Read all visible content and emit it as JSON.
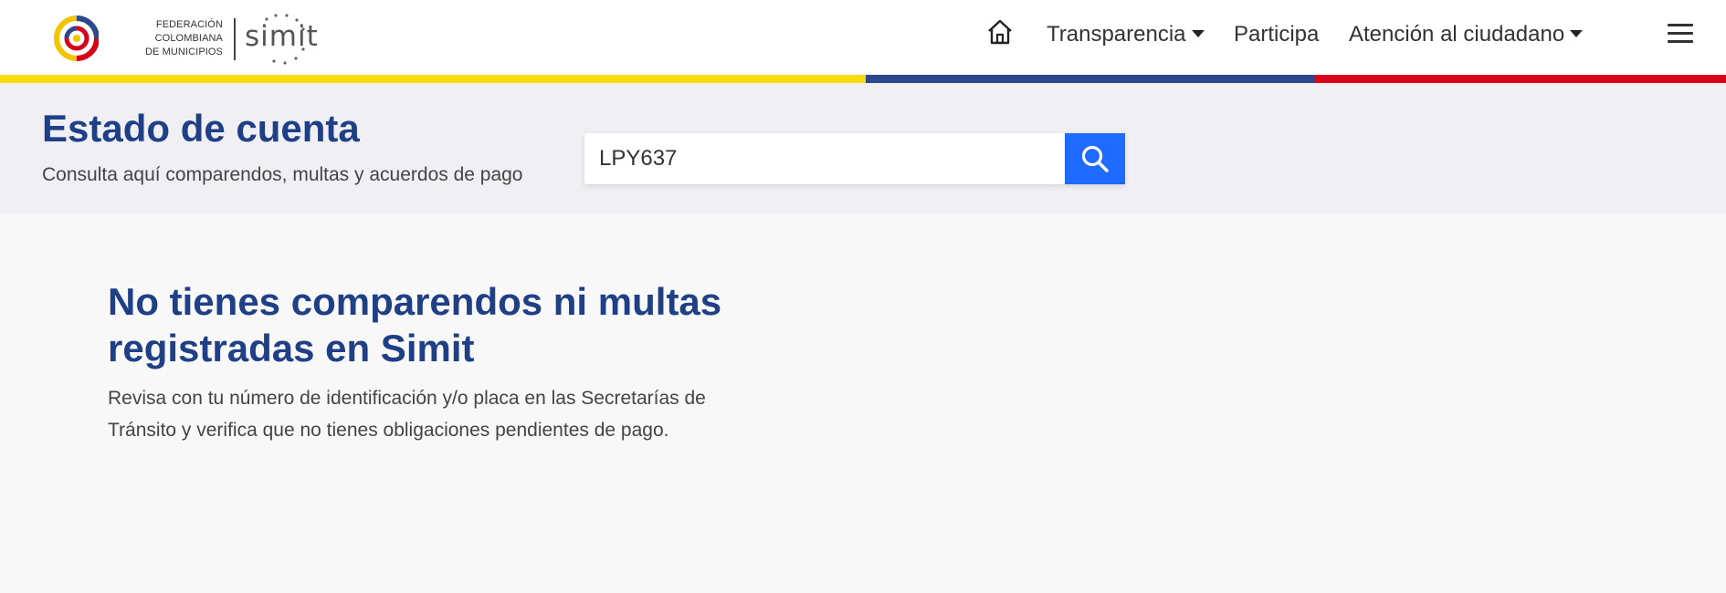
{
  "logo": {
    "federation_lines": [
      "FEDERACIÓN",
      "COLOMBIANA",
      "DE MUNICIPIOS"
    ],
    "brand": "simit"
  },
  "nav": {
    "home_icon": "home-icon",
    "items": [
      {
        "label": "Transparencia",
        "has_dropdown": true
      },
      {
        "label": "Participa",
        "has_dropdown": false
      },
      {
        "label": "Atención al ciudadano",
        "has_dropdown": true
      }
    ],
    "menu_icon": "hamburger-menu-icon"
  },
  "flag_colors": {
    "yellow": "#f9dc0b",
    "blue": "#2b4890",
    "red": "#d6001c"
  },
  "header": {
    "title": "Estado de cuenta",
    "subtitle": "Consulta aquí comparendos, multas y acuerdos de pago"
  },
  "search": {
    "value": "LPY637",
    "button_icon": "search-icon",
    "button_color": "#1f6bff"
  },
  "result": {
    "title": "No tienes comparendos ni multas registradas en Simit",
    "description": "Revisa con tu número de identificación y/o placa en las Secretarías de Tránsito y verifica que no tienes obligaciones pendientes de pago."
  },
  "colors": {
    "accent_text": "#1f3f86",
    "header_bg": "#efeff4",
    "page_bg": "#f8f8f9"
  }
}
